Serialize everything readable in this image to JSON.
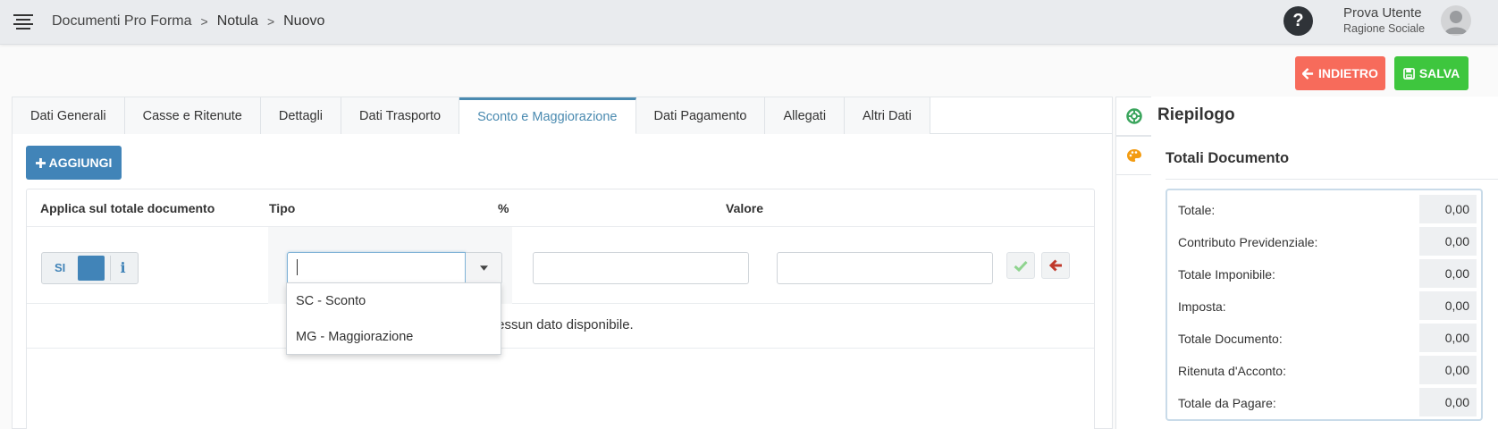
{
  "header": {
    "breadcrumb": [
      "Documenti Pro Forma",
      "Notula",
      "Nuovo"
    ],
    "help_label": "?",
    "user_name": "Prova Utente",
    "user_subtitle": "Ragione Sociale"
  },
  "actions": {
    "back_label": "INDIETRO",
    "save_label": "SALVA"
  },
  "tabs": [
    {
      "label": "Dati Generali",
      "active": false
    },
    {
      "label": "Casse e Ritenute",
      "active": false
    },
    {
      "label": "Dettagli",
      "active": false
    },
    {
      "label": "Dati Trasporto",
      "active": false
    },
    {
      "label": "Sconto e Maggiorazione",
      "active": true
    },
    {
      "label": "Dati Pagamento",
      "active": false
    },
    {
      "label": "Allegati",
      "active": false
    },
    {
      "label": "Altri Dati",
      "active": false
    }
  ],
  "add_label": "AGGIUNGI",
  "grid": {
    "columns": [
      "Applica sul totale documento",
      "Tipo",
      "%",
      "Valore"
    ],
    "toggle_label": "SI",
    "info_label": "i",
    "tipo_value": "",
    "perc_value": "",
    "valore_value": "",
    "no_data": "Nessun dato disponibile."
  },
  "dropdown": {
    "options": [
      "SC - Sconto",
      "MG - Maggiorazione"
    ]
  },
  "summary": {
    "title": "Riepilogo",
    "subtitle": "Totali Documento",
    "rows": [
      {
        "label": "Totale:",
        "value": "0,00"
      },
      {
        "label": "Contributo Previdenziale:",
        "value": "0,00"
      },
      {
        "label": "Totale Imponibile:",
        "value": "0,00"
      },
      {
        "label": "Imposta:",
        "value": "0,00"
      },
      {
        "label": "Totale Documento:",
        "value": "0,00"
      },
      {
        "label": "Ritenuta d'Acconto:",
        "value": "0,00"
      },
      {
        "label": "Totale da Pagare:",
        "value": "0,00"
      }
    ]
  },
  "colors": {
    "primary": "#4184b8",
    "danger": "#f76b5b",
    "success": "#3ec63e",
    "header_bg": "#e9ebee"
  },
  "icons": {
    "menu": "hamburger-menu-icon",
    "help": "question-circle-icon",
    "avatar": "user-avatar-icon",
    "back": "arrow-left-icon",
    "save": "floppy-disk-icon",
    "add": "plus-icon",
    "confirm": "check-icon",
    "cancel": "arrow-left-icon",
    "side_tab_1": "lifebuoy-icon",
    "side_tab_2": "palette-icon"
  }
}
